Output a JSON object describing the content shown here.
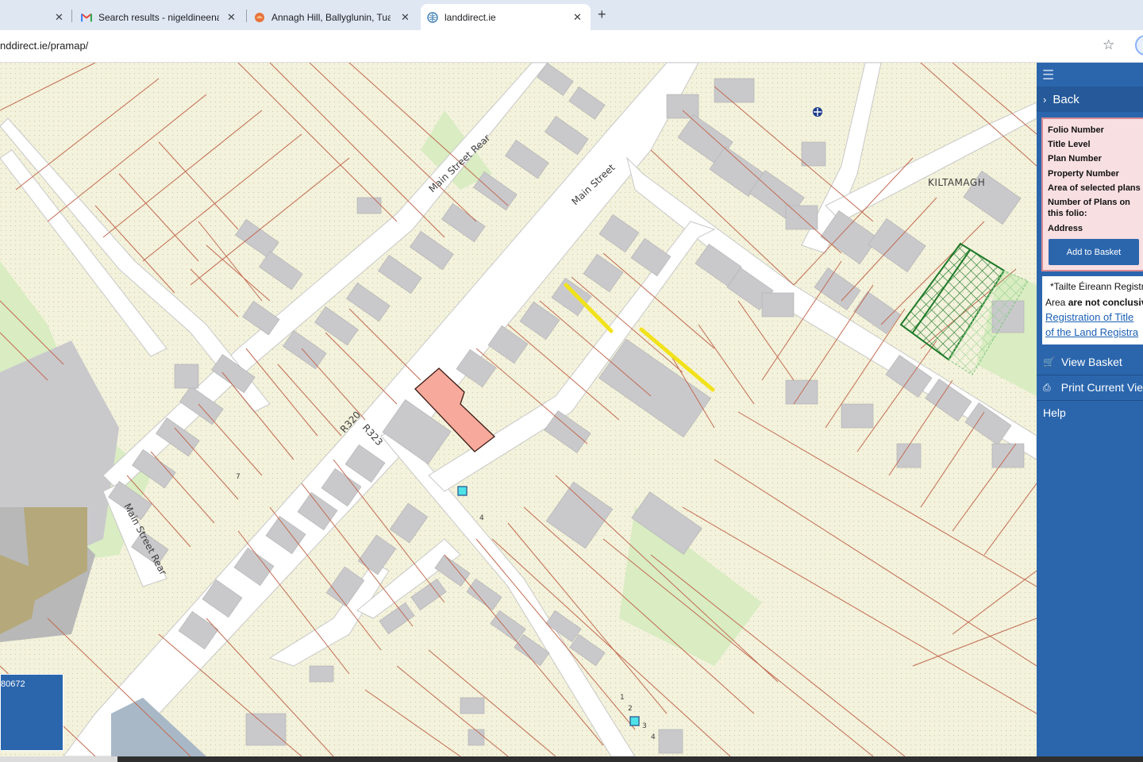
{
  "browser": {
    "tabs": [
      {
        "title": "",
        "icon": "blank-icon"
      },
      {
        "title": "Search results - nigeldineenauc",
        "icon": "gmail-icon"
      },
      {
        "title": "Annagh Hill, Ballyglunin, Tuam,",
        "icon": "site-icon"
      },
      {
        "title": "landdirect.ie",
        "icon": "landdirect-icon"
      }
    ],
    "url": "nddirect.ie/pramap/"
  },
  "map": {
    "labels": {
      "main_street_rear_top": "Main Street Rear",
      "main_street": "Main Street",
      "kiltamagh": "KILTAMAGH",
      "r320": "R320",
      "r323": "R323",
      "main_street_rear_left": "Main Street Rear",
      "n7": "7",
      "n4": "4",
      "n1": "1",
      "n2": "2",
      "n3": "3",
      "n4b": "4"
    },
    "folio_number": "80672",
    "colors": {
      "background": "#f3f2dc",
      "road": "#ffffff",
      "building": "#c9c9cc",
      "boundary": "#c26b52",
      "selected_parcel": "#f7a99b",
      "highlight": "#f1e21b",
      "hatched": "#1f7a2a",
      "grass": "#d9ecc2"
    }
  },
  "panel": {
    "back_label": "Back",
    "fields": [
      "Folio Number",
      "Title Level",
      "Plan Number",
      "Property Number",
      "Area of selected plans",
      "Number of Plans on this folio:",
      "Address"
    ],
    "add_to_basket_label": "Add to Basket",
    "notice": {
      "line1": "*Tailte Éireann Registra",
      "line2_prefix": "Area ",
      "line2_bold": "are not conclusiv",
      "link1": "Registration of Title",
      "link2": "of the Land Registra"
    },
    "view_basket_label": "View Basket",
    "print_label": "Print Current Vie",
    "help_label": "Help"
  }
}
